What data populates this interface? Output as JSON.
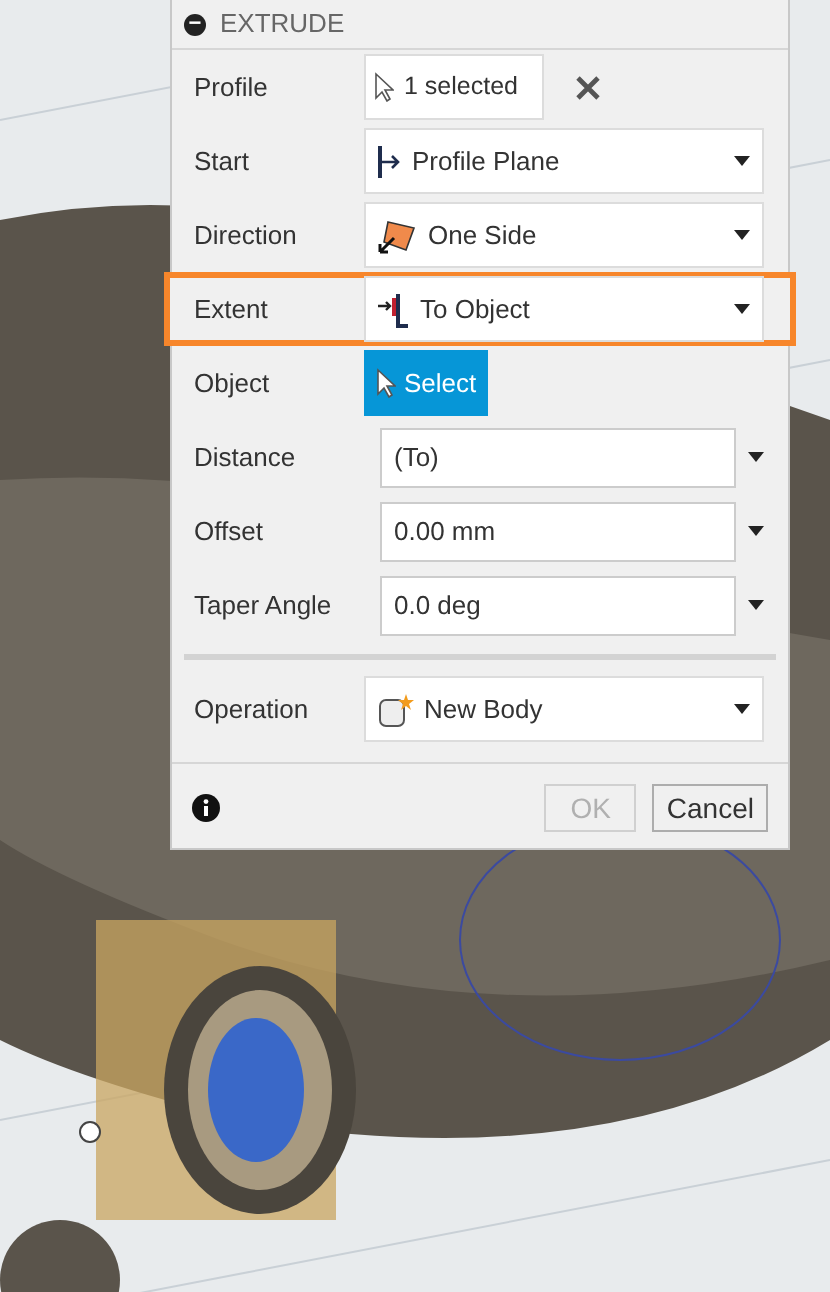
{
  "dialog": {
    "title": "EXTRUDE",
    "collapse_symbol": "−",
    "rows": [
      {
        "kind": "selection",
        "label": "Profile",
        "value": "1 selected",
        "highlighted": false
      },
      {
        "kind": "dropdown",
        "label": "Start",
        "value": "Profile Plane",
        "highlighted": false
      },
      {
        "kind": "dropdown",
        "label": "Direction",
        "value": "One Side",
        "highlighted": false
      },
      {
        "kind": "dropdown",
        "label": "Extent",
        "value": "To Object",
        "highlighted": true
      },
      {
        "kind": "button",
        "label": "Object",
        "value": "Select",
        "highlighted": false
      },
      {
        "kind": "input",
        "label": "Distance",
        "value": "(To)",
        "highlighted": false
      },
      {
        "kind": "input",
        "label": "Offset",
        "value": "0.00 mm",
        "highlighted": false
      },
      {
        "kind": "input",
        "label": "Taper Angle",
        "value": "0.0 deg",
        "highlighted": false
      },
      {
        "kind": "divider"
      },
      {
        "kind": "dropdown",
        "label": "Operation",
        "value": "New Body",
        "highlighted": false
      }
    ],
    "buttons": [
      {
        "label": "OK",
        "disabled": true
      },
      {
        "label": "Cancel",
        "disabled": false
      }
    ]
  }
}
